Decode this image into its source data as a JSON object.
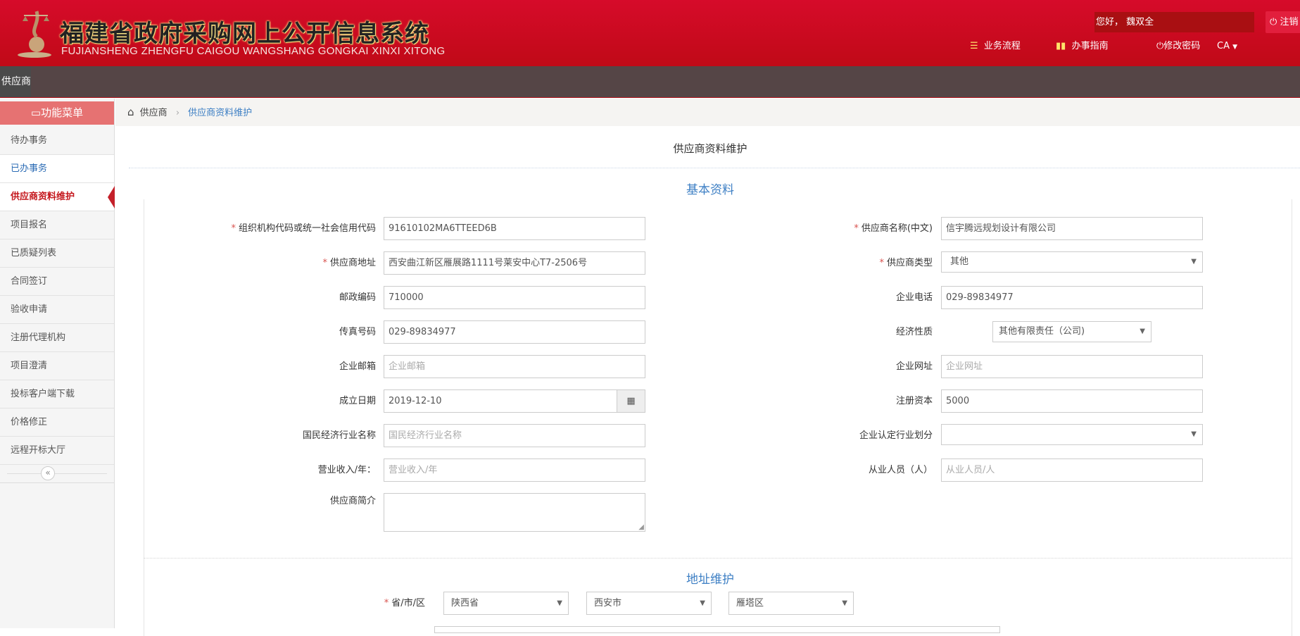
{
  "header": {
    "title": "福建省政府采购网上公开信息系统",
    "subtitle": "FUJIANSHENG ZHENGFU CAIGOU WANGSHANG GONGKAI XINXI XITONG",
    "greeting": "您好，  魏双全",
    "logout": "注销",
    "links": [
      {
        "label": "业务流程",
        "icon": "list-icon"
      },
      {
        "label": "办事指南",
        "icon": "book-icon"
      },
      {
        "label": "修改密码",
        "icon": "power-icon"
      },
      {
        "label": "CA",
        "icon": "caret-down-icon"
      }
    ],
    "brand_color": "#d00a22"
  },
  "nav": {
    "tab": "供应商"
  },
  "sidebar": {
    "title": "功能菜单",
    "items": [
      {
        "label": "待办事务"
      },
      {
        "label": "已办事务"
      },
      {
        "label": "供应商资料维护"
      },
      {
        "label": "项目报名"
      },
      {
        "label": "已质疑列表"
      },
      {
        "label": "合同签订"
      },
      {
        "label": "验收申请"
      },
      {
        "label": "注册代理机构"
      },
      {
        "label": "项目澄清"
      },
      {
        "label": "投标客户端下载"
      },
      {
        "label": "价格修正"
      },
      {
        "label": "远程开标大厅"
      }
    ],
    "active": "供应商资料维护",
    "collapse": "«"
  },
  "breadcrumb": {
    "home": "供应商",
    "sep": "›",
    "current": "供应商资料维护"
  },
  "page": {
    "title": "供应商资料维护",
    "section1": "基本资料",
    "section2": "地址维护"
  },
  "form": {
    "left": [
      {
        "label": "组织机构代码或统一社会信用代码",
        "required": true,
        "value": "91610102MA6TTEED6B"
      },
      {
        "label": "供应商地址",
        "required": true,
        "value": "西安曲江新区雁展路1111号莱安中心T7-2506号"
      },
      {
        "label": "邮政编码",
        "value": "710000"
      },
      {
        "label": "传真号码",
        "value": "029-89834977"
      },
      {
        "label": "企业邮箱",
        "placeholder": "企业邮箱"
      },
      {
        "label": "成立日期",
        "value": "2019-12-10"
      },
      {
        "label": "国民经济行业名称",
        "placeholder": "国民经济行业名称"
      },
      {
        "label": "营业收入/年：",
        "placeholder": "营业收入/年"
      },
      {
        "label": "供应商简介",
        "value": ""
      }
    ],
    "right": [
      {
        "label": "供应商名称(中文)",
        "required": true,
        "value": "信宇腾远规划设计有限公司"
      },
      {
        "label": "供应商类型",
        "required": true,
        "value": "其他"
      },
      {
        "label": "企业电话",
        "value": "029-89834977"
      },
      {
        "label": "经济性质",
        "value": "其他有限责任（公司)"
      },
      {
        "label": "企业网址",
        "placeholder": "企业网址"
      },
      {
        "label": "注册资本",
        "value": "5000"
      },
      {
        "label": "企业认定行业划分",
        "value": ""
      },
      {
        "label": "从业人员（人）",
        "placeholder": "从业人员/人"
      }
    ],
    "address": {
      "label": "省/市/区",
      "province": "陕西省",
      "city": "西安市",
      "district": "雁塔区"
    }
  }
}
